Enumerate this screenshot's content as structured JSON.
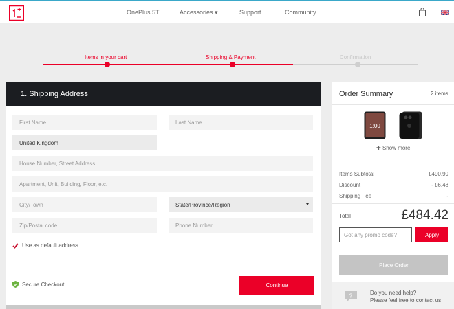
{
  "header": {
    "nav": [
      "OnePlus 5T",
      "Accessories ▾",
      "Support",
      "Community"
    ],
    "colors": {
      "accent": "#eb0028",
      "top_border": "#3aa8c9"
    }
  },
  "progress": {
    "steps": [
      {
        "label": "Items in your cart",
        "state": "complete"
      },
      {
        "label": "Shipping & Payment",
        "state": "current"
      },
      {
        "label": "Confirmation",
        "state": "upcoming"
      }
    ],
    "fraction_complete": 0.5
  },
  "shipping": {
    "title": "1. Shipping Address",
    "first_name": {
      "placeholder": "First Name"
    },
    "last_name": {
      "placeholder": "Last Name"
    },
    "country": {
      "value": "United Kingdom"
    },
    "address1": {
      "placeholder": "House Number, Street Address"
    },
    "address2": {
      "placeholder": "Apartment, Unit, Building, Floor, etc."
    },
    "city": {
      "placeholder": "City/Town"
    },
    "state": {
      "value": "State/Province/Region"
    },
    "zip": {
      "placeholder": "Zip/Postal code"
    },
    "phone": {
      "placeholder": "Phone Number"
    },
    "default_label": "Use as default address",
    "secure_label": "Secure Checkout",
    "continue_label": "Continue"
  },
  "summary": {
    "title": "Order Summary",
    "count": "2 items",
    "show_more": "Show more",
    "rows": [
      {
        "label": "Items Subtotal",
        "value": "£490.90"
      },
      {
        "label": "Discount",
        "value": "- £6.48"
      },
      {
        "label": "Shipping Fee",
        "value": "-"
      }
    ],
    "total_label": "Total",
    "total_value": "£484.42",
    "promo_placeholder": "Got any promo code?",
    "apply_label": "Apply",
    "place_order_label": "Place Order",
    "help_line1": "Do you need help?",
    "help_line2": "Please feel free to contact us"
  }
}
